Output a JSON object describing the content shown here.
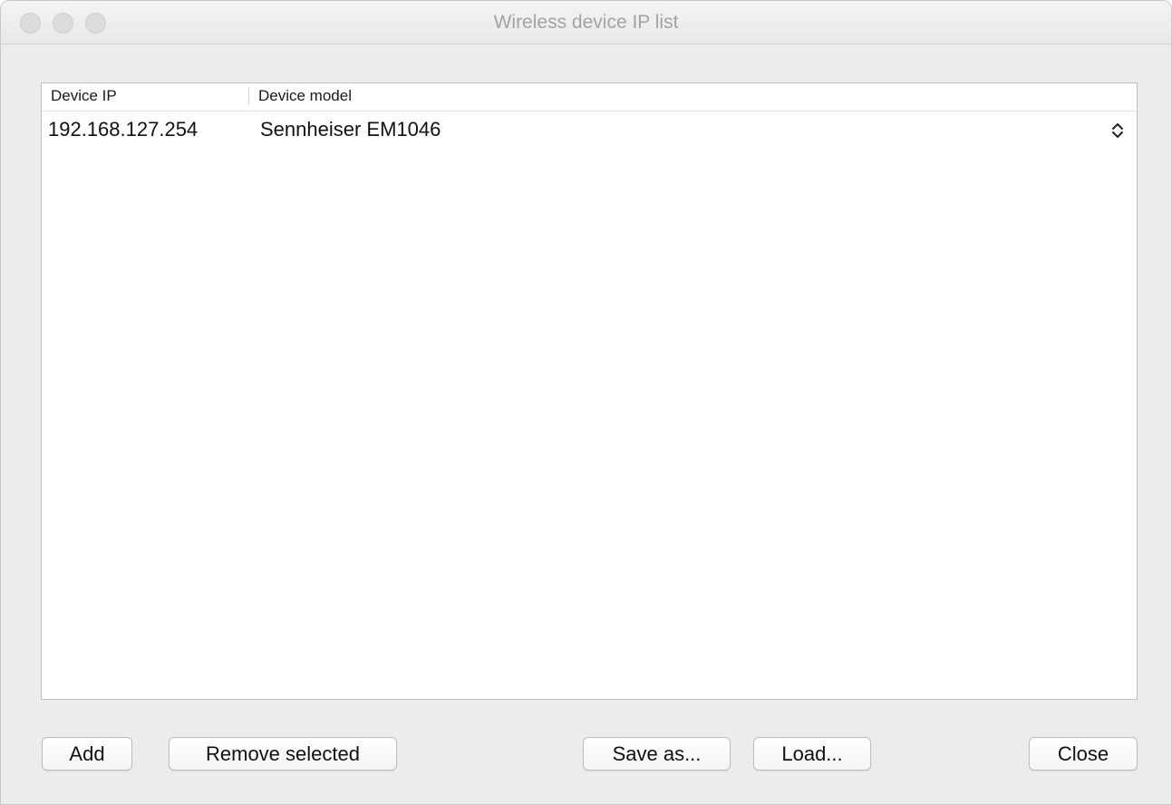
{
  "window": {
    "title": "Wireless device IP list"
  },
  "table": {
    "columns": [
      "Device IP",
      "Device model"
    ],
    "rows": [
      {
        "ip": "192.168.127.254",
        "model": "Sennheiser EM1046"
      }
    ]
  },
  "buttons": {
    "add": "Add",
    "remove_selected": "Remove selected",
    "save_as": "Save as...",
    "load": "Load...",
    "close": "Close"
  },
  "icons": {
    "window_controls": [
      "close-traffic-icon",
      "minimize-traffic-icon",
      "zoom-traffic-icon"
    ],
    "row_stepper": "up-down-chevron-icon"
  },
  "colors": {
    "window_bg": "#ececec",
    "title_text": "#a3a3a3",
    "table_bg": "#ffffff"
  }
}
